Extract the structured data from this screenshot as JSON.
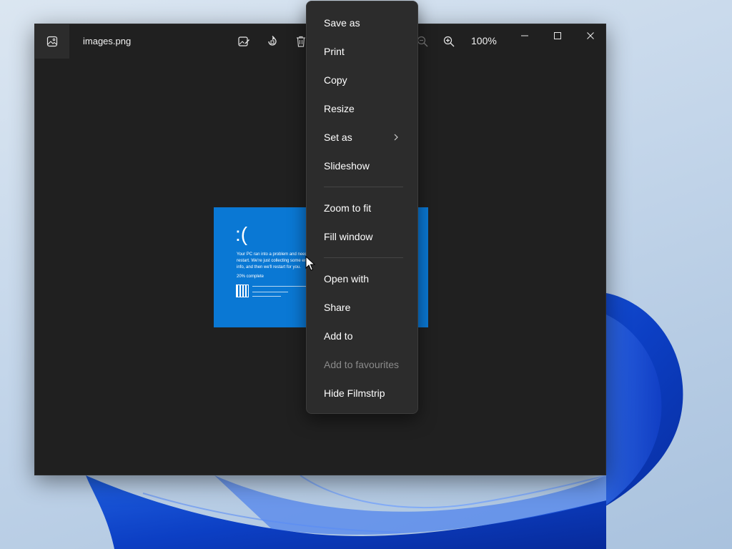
{
  "window": {
    "file_name": "images.png",
    "zoom_level": "100%",
    "toolbar_icons": [
      "edit-image-icon",
      "rotate-icon",
      "delete-icon",
      "zoom-out-icon",
      "zoom-in-icon"
    ],
    "controls": [
      "minimize-icon",
      "maximize-icon",
      "close-icon"
    ]
  },
  "photo": {
    "face": ":(",
    "message": "Your PC ran into a problem and needs to restart. We're just collecting some error info, and then we'll restart for you.",
    "progress": "20% complete"
  },
  "context_menu": {
    "items": [
      {
        "label": "Save as",
        "enabled": true
      },
      {
        "label": "Print",
        "enabled": true
      },
      {
        "label": "Copy",
        "enabled": true
      },
      {
        "label": "Resize",
        "enabled": true
      },
      {
        "label": "Set as",
        "enabled": true,
        "has_submenu": true
      },
      {
        "label": "Slideshow",
        "enabled": true
      },
      {
        "label": "Zoom to fit",
        "enabled": true
      },
      {
        "label": "Fill window",
        "enabled": true
      },
      {
        "label": "Open with",
        "enabled": true
      },
      {
        "label": "Share",
        "enabled": true
      },
      {
        "label": "Add to",
        "enabled": true
      },
      {
        "label": "Add to favourites",
        "enabled": false
      },
      {
        "label": "Hide Filmstrip",
        "enabled": true
      }
    ]
  },
  "colors": {
    "window_bg": "#202020",
    "menu_bg": "#2c2c2c",
    "bsod_blue": "#0a78d4",
    "disabled_text": "#8a8a8a"
  }
}
